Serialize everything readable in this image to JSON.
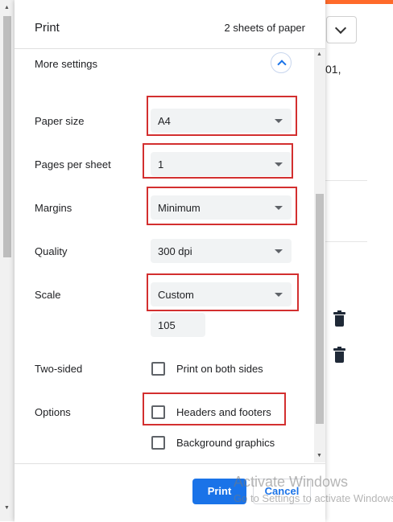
{
  "dialog": {
    "title": "Print",
    "sheets": "2 sheets of paper"
  },
  "more_settings": {
    "label": "More settings",
    "icon": "chevron-up-icon"
  },
  "settings": {
    "paper_size": {
      "label": "Paper size",
      "value": "A4"
    },
    "pages_per_sheet": {
      "label": "Pages per sheet",
      "value": "1"
    },
    "margins": {
      "label": "Margins",
      "value": "Minimum"
    },
    "quality": {
      "label": "Quality",
      "value": "300 dpi"
    },
    "scale": {
      "label": "Scale",
      "value": "Custom",
      "custom_value": "105"
    },
    "two_sided": {
      "label": "Two-sided",
      "option": "Print on both sides",
      "checked": false
    },
    "options": {
      "label": "Options",
      "items": [
        {
          "label": "Headers and footers",
          "checked": false
        },
        {
          "label": "Background graphics",
          "checked": false
        }
      ]
    }
  },
  "footer": {
    "print_label": "Print",
    "cancel_label": "Cancel"
  },
  "background": {
    "partial_text": "01,",
    "icons": [
      "trash-icon",
      "trash-icon",
      "chevron-down-icon"
    ]
  },
  "watermark": {
    "line1": "Activate Windows",
    "line2": "Go to Settings to activate Windows."
  },
  "colors": {
    "accent": "#1a73e8",
    "highlight": "#d32f2f",
    "topbar": "#ff6a2a"
  }
}
